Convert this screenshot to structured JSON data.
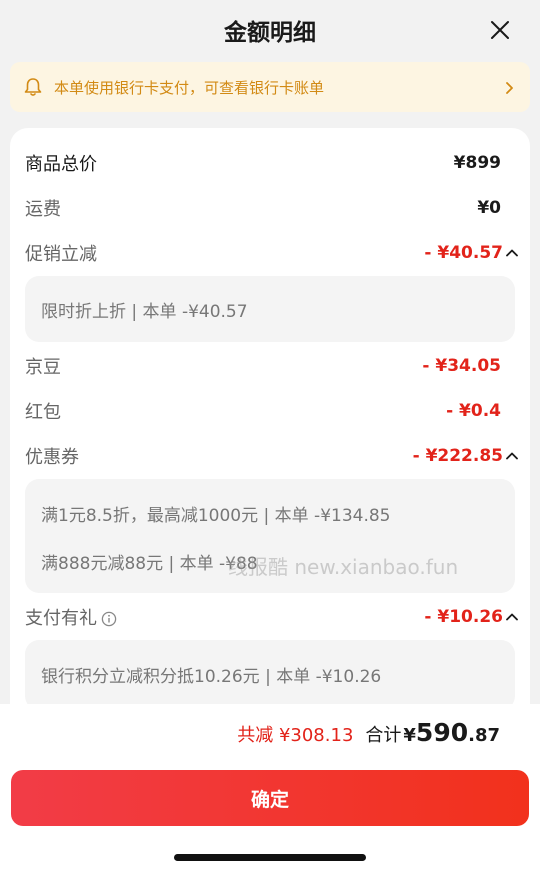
{
  "header": {
    "title": "金额明细",
    "close_icon": "close-icon"
  },
  "notice": {
    "text": "本单使用银行卡支付，可查看银行卡账单",
    "icon": "bell-icon",
    "color": "#d28a14"
  },
  "rows": {
    "goods_total": {
      "label": "商品总价",
      "value": "¥899"
    },
    "shipping": {
      "label": "运费",
      "value": "¥0"
    },
    "promo": {
      "label": "促销立减",
      "value": "- ¥40.57",
      "detail": "限时折上折 | 本单 -¥40.57"
    },
    "jingdou": {
      "label": "京豆",
      "value": "- ¥34.05"
    },
    "hongbao": {
      "label": "红包",
      "value": "- ¥0.4"
    },
    "coupon": {
      "label": "优惠券",
      "value": "- ¥222.85",
      "details": [
        "满1元8.5折，最高减1000元 | 本单 -¥134.85",
        "满888元减88元 | 本单 -¥88"
      ]
    },
    "pay_gift": {
      "label": "支付有礼",
      "value": "- ¥10.26",
      "detail": "银行积分立减积分抵10.26元 | 本单 -¥10.26"
    }
  },
  "watermark": "线报酷 new.xianbao.fun",
  "footer": {
    "saved": "共减 ¥308.13",
    "total_label": "合计",
    "currency": "¥",
    "total_int": "590",
    "total_dec": ".87",
    "confirm_label": "确定"
  },
  "colors": {
    "accent_red": "#e2231a",
    "button_start": "#f23c47",
    "button_end": "#f2311c"
  }
}
